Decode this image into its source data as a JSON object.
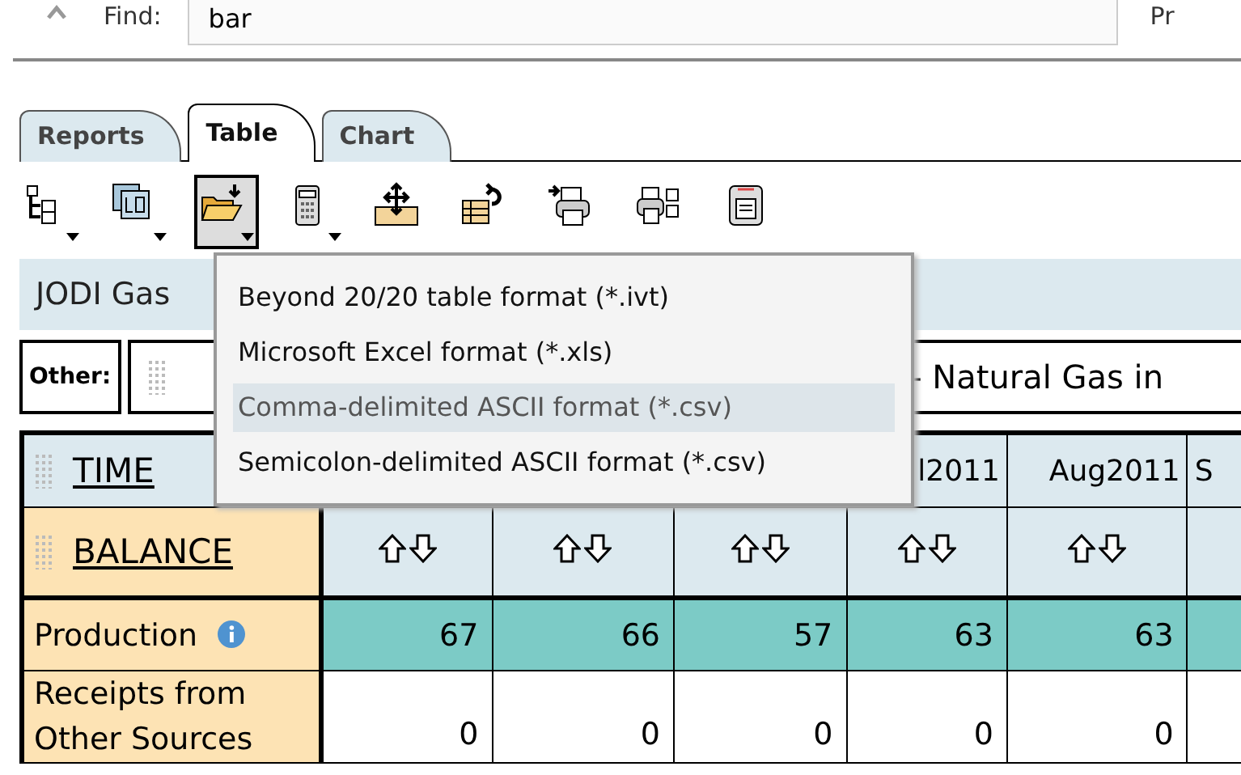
{
  "find_bar": {
    "label": "Find:",
    "value": "bar",
    "trailing_text": "Pr"
  },
  "tabs": [
    {
      "label": "Reports",
      "selected": false
    },
    {
      "label": "Table",
      "selected": true
    },
    {
      "label": "Chart",
      "selected": false
    }
  ],
  "toolbar": [
    {
      "kind": "layout",
      "dropdown": true,
      "pressed": false
    },
    {
      "kind": "layouts",
      "dropdown": true,
      "pressed": false
    },
    {
      "kind": "open",
      "dropdown": true,
      "pressed": true
    },
    {
      "kind": "calculator",
      "dropdown": true,
      "pressed": false
    },
    {
      "kind": "move",
      "dropdown": false,
      "pressed": false
    },
    {
      "kind": "swap",
      "dropdown": false,
      "pressed": false
    },
    {
      "kind": "print",
      "dropdown": false,
      "pressed": false
    },
    {
      "kind": "print-setup",
      "dropdown": false,
      "pressed": false
    },
    {
      "kind": "save",
      "dropdown": false,
      "pressed": false
    }
  ],
  "report_title": "JODI Gas",
  "dimension_bar": {
    "label": "Other:",
    "value": "- Natural Gas in"
  },
  "menu": [
    {
      "label": "Beyond 20/20 table format (*.ivt)",
      "selected": false
    },
    {
      "label": "Microsoft Excel format (*.xls)",
      "selected": false
    },
    {
      "label": "Comma-delimited ASCII format (*.csv)",
      "selected": true
    },
    {
      "label": "Semicolon-delimited ASCII format (*.csv)",
      "selected": false
    }
  ],
  "table": {
    "column_dimension": "TIME",
    "row_dimension": "BALANCE",
    "columns": [
      "",
      "",
      "",
      "l2011",
      "Aug2011",
      "S"
    ],
    "sortable": [
      true,
      true,
      true,
      true,
      true,
      false
    ],
    "rows": [
      {
        "label": "Production",
        "info": true,
        "highlighted": true,
        "cells": [
          "67",
          "66",
          "57",
          "63",
          "63",
          ""
        ]
      },
      {
        "label": "Receipts from Other Sources",
        "info": false,
        "highlighted": false,
        "cells": [
          "0",
          "0",
          "0",
          "0",
          "0",
          ""
        ]
      }
    ]
  }
}
